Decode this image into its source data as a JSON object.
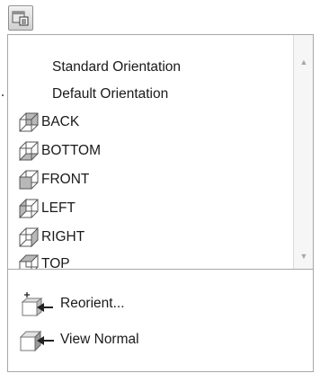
{
  "toolbar": {
    "view_orientation_button_icon": "view-orientation-icon"
  },
  "orientation_list": {
    "named_views": [
      {
        "label": "Standard Orientation"
      },
      {
        "label": "Default Orientation"
      }
    ],
    "standard_views": [
      {
        "label": "BACK",
        "icon": "back-view-cube-icon"
      },
      {
        "label": "BOTTOM",
        "icon": "bottom-view-cube-icon"
      },
      {
        "label": "FRONT",
        "icon": "front-view-cube-icon"
      },
      {
        "label": "LEFT",
        "icon": "left-view-cube-icon"
      },
      {
        "label": "RIGHT",
        "icon": "right-view-cube-icon"
      },
      {
        "label": "TOP",
        "icon": "top-view-cube-icon"
      }
    ],
    "scrollbar": {
      "up_arrow": "▲",
      "down_arrow": "▼"
    }
  },
  "commands": [
    {
      "label": "Reorient...",
      "icon": "reorient-icon"
    },
    {
      "label": "View Normal",
      "icon": "view-normal-icon"
    }
  ],
  "colors": {
    "panel_border": "#a7a7a7",
    "cube_line": "#555555",
    "cube_fill_highlight": "#b8b8b8",
    "arrow_dark": "#2a2a2a"
  }
}
